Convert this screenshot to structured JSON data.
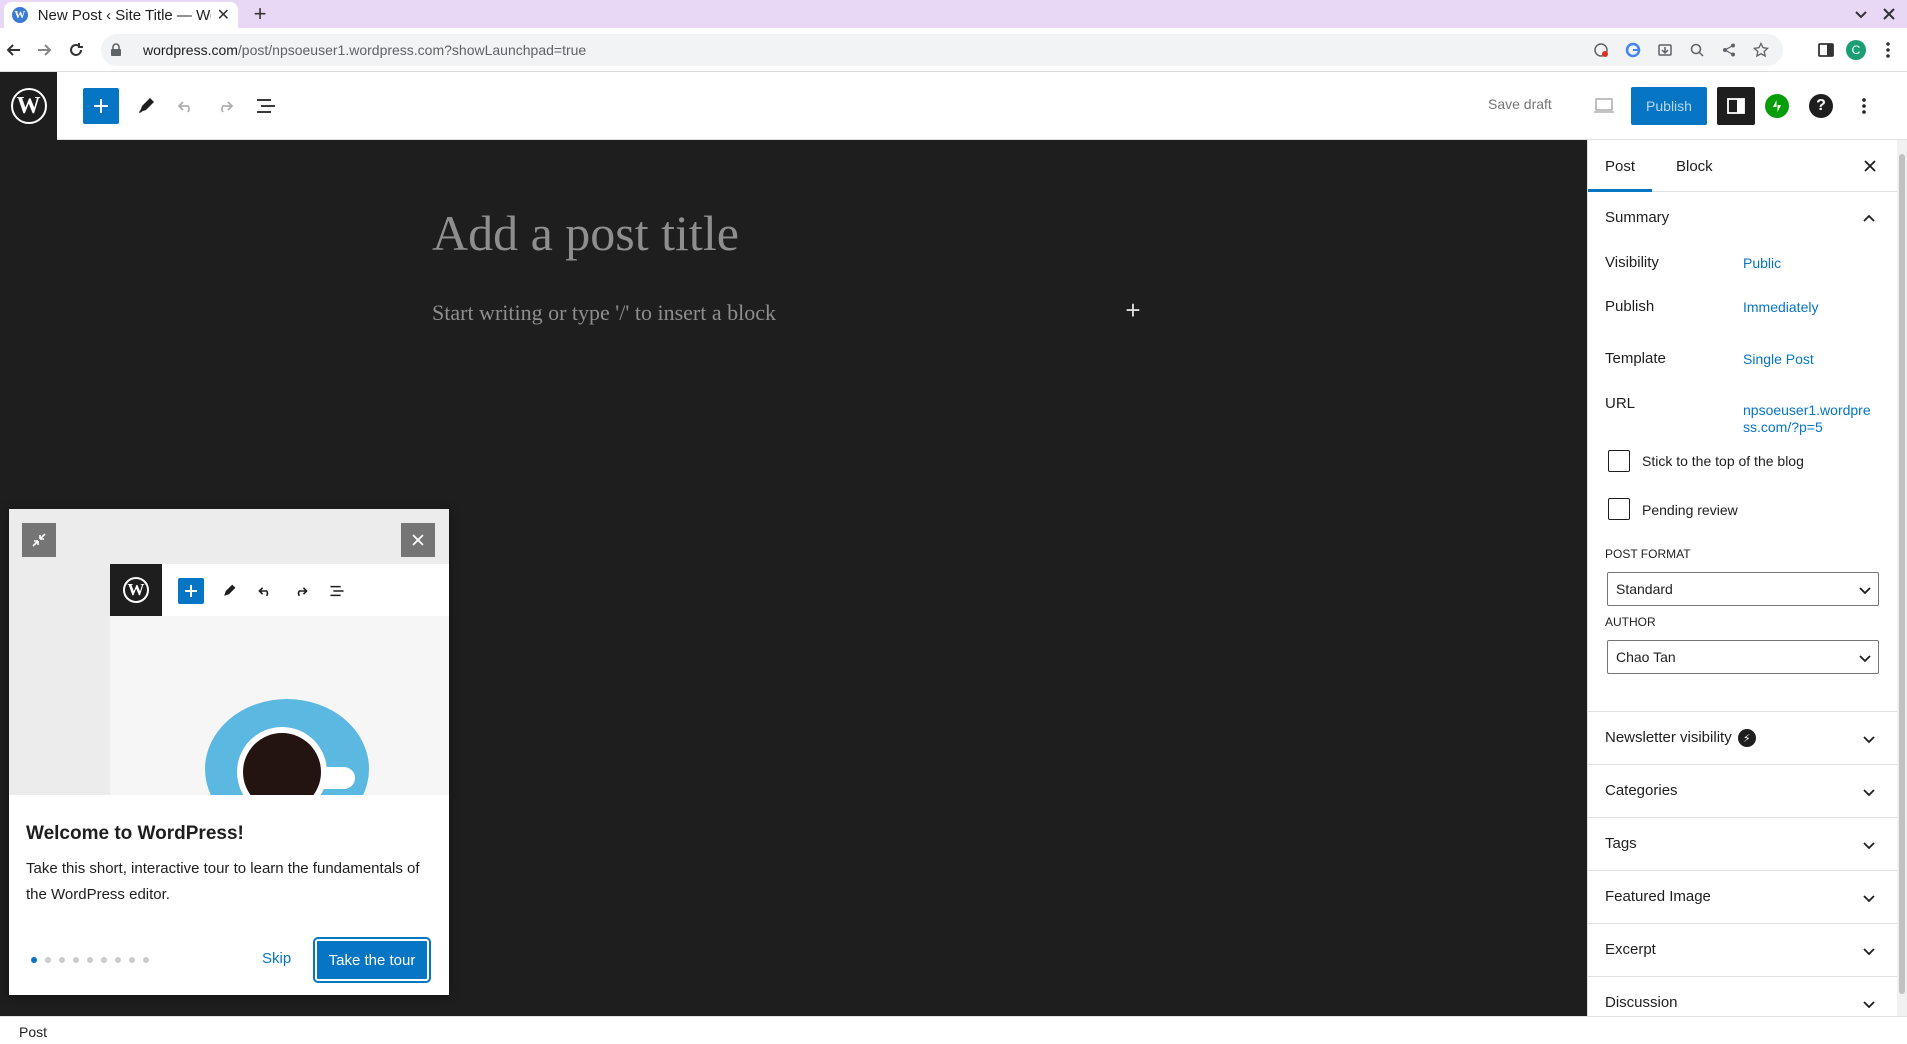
{
  "browser": {
    "tab_title": "New Post ‹ Site Title — Wo",
    "favicon_letter": "W",
    "url_host": "wordpress.com",
    "url_rest": "/post/npsoeuser1.wordpress.com?showLaunchpad=true",
    "profile_initial": "C"
  },
  "editor": {
    "save_draft_label": "Save draft",
    "publish_label": "Publish",
    "logo_letter": "W",
    "title_placeholder": "Add a post title",
    "block_placeholder": "Start writing or type '/' to insert a block"
  },
  "guide": {
    "title": "Welcome to WordPress!",
    "text": "Take this short, interactive tour to learn the fundamentals of the WordPress editor.",
    "skip_label": "Skip",
    "tour_label": "Take the tour",
    "dots_total": 9,
    "dots_active": 1
  },
  "sidebar": {
    "tab_post": "Post",
    "tab_block": "Block",
    "summary": {
      "heading": "Summary",
      "visibility_label": "Visibility",
      "visibility_value": "Public",
      "publish_label": "Publish",
      "publish_value": "Immediately",
      "template_label": "Template",
      "template_value": "Single Post",
      "url_label": "URL",
      "url_value": "npsoeuser1.wordpress.com/?p=5",
      "sticky_label": "Stick to the top of the blog",
      "pending_label": "Pending review",
      "post_format_label": "POST FORMAT",
      "post_format_value": "Standard",
      "author_label": "AUTHOR",
      "author_value": "Chao Tan"
    },
    "panels": {
      "newsletter": "Newsletter visibility",
      "categories": "Categories",
      "tags": "Tags",
      "featured_image": "Featured Image",
      "excerpt": "Excerpt",
      "discussion": "Discussion"
    }
  },
  "footer": {
    "breadcrumb": "Post"
  },
  "colors": {
    "accent": "#0675c4",
    "canvas_bg": "#1e1e1e",
    "tabbar_bg": "#e8d8f5",
    "jetpack_green": "#069e08"
  }
}
